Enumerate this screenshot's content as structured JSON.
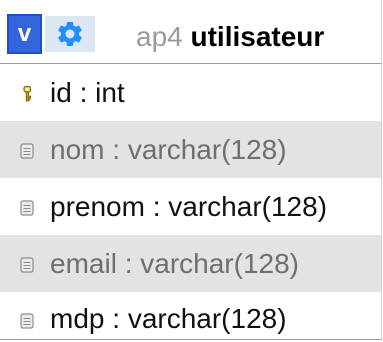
{
  "table": {
    "database": "ap4",
    "name": "utilisateur",
    "view_button_label": "v",
    "columns": [
      {
        "name": "id",
        "separator": " : ",
        "type": "int",
        "key": "primary",
        "icon": "key-icon"
      },
      {
        "name": "nom",
        "separator": " : ",
        "type": "varchar(128)",
        "key": "none",
        "icon": "column-icon"
      },
      {
        "name": "prenom",
        "separator": " : ",
        "type": "varchar(128)",
        "key": "none",
        "icon": "column-icon"
      },
      {
        "name": "email",
        "separator": " : ",
        "type": "varchar(128)",
        "key": "none",
        "icon": "column-icon"
      },
      {
        "name": "mdp",
        "separator": " : ",
        "type": "varchar(128)",
        "key": "none",
        "icon": "column-icon"
      }
    ]
  },
  "colors": {
    "accent": "#3366dd",
    "gear_background": "#dbe8f3",
    "gear_icon": "#1e90ff",
    "row_shade": "#e3e3e3",
    "database_text": "#9a9a9a"
  }
}
